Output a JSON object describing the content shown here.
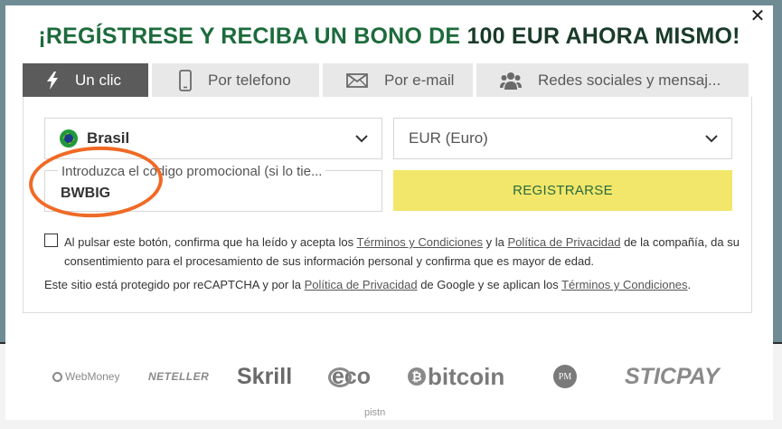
{
  "modal": {
    "close_icon": "close-icon",
    "headline_prefix": "¡REGÍSTRESE Y RECIBA UN BONO DE ",
    "headline_amount": "100 EUR AHORA MISMO!"
  },
  "tabs": [
    {
      "label": "Un clic",
      "icon": "lightning-icon",
      "active": true
    },
    {
      "label": "Por telefono",
      "icon": "phone-icon",
      "active": false
    },
    {
      "label": "Por e-mail",
      "icon": "envelope-icon",
      "active": false
    },
    {
      "label": "Redes sociales y mensaj...",
      "icon": "people-icon",
      "active": false
    }
  ],
  "form": {
    "country": {
      "value": "Brasil",
      "icon": "brazil-flag-icon"
    },
    "currency": {
      "value": "EUR (Euro)"
    },
    "promo": {
      "label": "Introduzca el código promocional (si lo tie...",
      "value": "BWBIG"
    },
    "register_label": "REGISTRARSE",
    "consent": {
      "t1": "Al pulsar este botón, confirma que ha leído y acepta los ",
      "link_terms": "Términos y Condiciones",
      "t2": " y la ",
      "link_privacy": "Política de Privacidad",
      "t3": " de la compañía, da su consentimiento para el procesamiento de sus información personal y confirma que es mayor de edad."
    },
    "captcha": {
      "t1": "Este sitio está protegido por reCAPTCHA y por la ",
      "link_privacy": "Política de Privacidad",
      "t2": " de Google y se aplican los ",
      "link_terms": "Términos y Condiciones",
      "t3": "."
    }
  },
  "payments": {
    "webmoney": "WebMoney",
    "neteller": "NETELLER",
    "skrill": "Skrill",
    "eco": "eco",
    "bitcoin": "bitcoin",
    "bitcoin_symbol": "₿",
    "pm": "PM",
    "sticpay": "STICPAY",
    "partial": "pistn"
  },
  "colors": {
    "headline_green": "#1d6b3c",
    "register_button": "#f2e76a",
    "active_tab": "#5b5b5b",
    "highlight_ring": "#f06a25"
  }
}
